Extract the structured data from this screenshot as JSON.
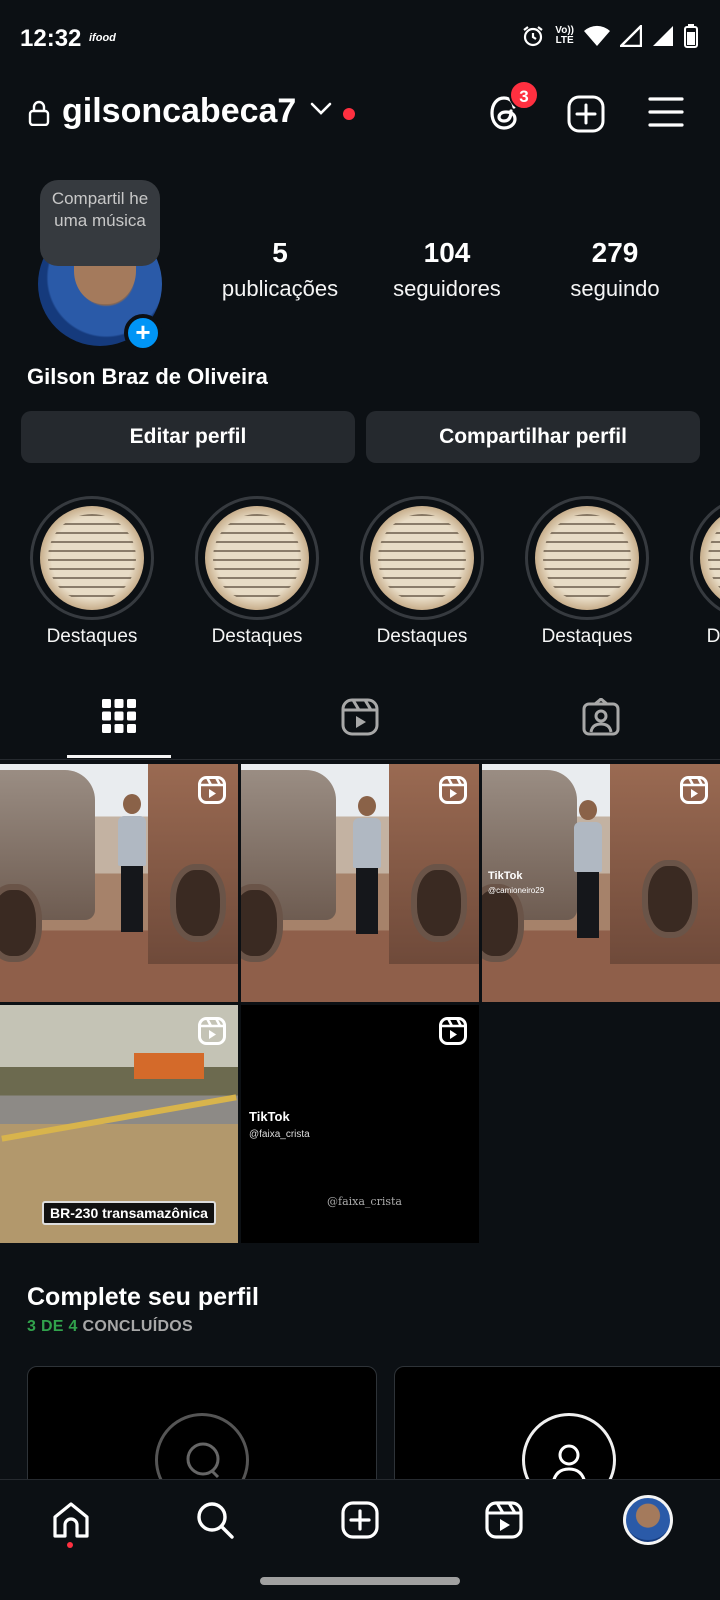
{
  "status_bar": {
    "time": "12:32",
    "app_notification": "ifood",
    "volte_line1": "Vo))",
    "volte_line2": "LTE",
    "icons": [
      "alarm-icon",
      "volte-icon",
      "wifi-icon",
      "signal-icon",
      "signal-icon",
      "battery-icon"
    ]
  },
  "header": {
    "username": "gilsoncabeca7",
    "threads_badge": "3",
    "icons": [
      "lock-icon",
      "chevron-down-icon",
      "threads-icon",
      "create-icon",
      "menu-icon"
    ]
  },
  "profile": {
    "note": "Compartil he uma música",
    "stats": {
      "posts_count": "5",
      "posts_label": "publicações",
      "followers_count": "104",
      "followers_label": "seguidores",
      "following_count": "279",
      "following_label": "seguindo"
    },
    "full_name": "Gilson Braz de Oliveira",
    "edit_button": "Editar perfil",
    "share_button": "Compartilhar perfil"
  },
  "highlights": [
    {
      "label": "Destaques"
    },
    {
      "label": "Destaques"
    },
    {
      "label": "Destaques"
    },
    {
      "label": "Destaques"
    },
    {
      "label": "Destaques"
    }
  ],
  "tabs": [
    "grid-icon",
    "reels-icon",
    "tagged-icon"
  ],
  "grid": {
    "posts": [
      {
        "type": "reel"
      },
      {
        "type": "reel"
      },
      {
        "type": "reel",
        "overlay_brand": "TikTok",
        "overlay_handle": "@camioneiro29"
      },
      {
        "type": "reel",
        "caption": "BR-230 transamazônica"
      },
      {
        "type": "reel",
        "overlay_brand": "TikTok",
        "overlay_handle": "@faixa_crista",
        "overlay_handle2": "@faixa_crista"
      }
    ]
  },
  "complete_profile": {
    "title": "Complete seu perfil",
    "progress_done": "3 DE 4",
    "progress_label": "CONCLUÍDOS"
  },
  "bottom_nav": [
    "home-icon",
    "search-icon",
    "create-icon",
    "reels-icon",
    "profile-avatar"
  ],
  "colors": {
    "background": "#0c1014",
    "button": "#25292e",
    "accent_blue": "#0095f6",
    "badge_red": "#ff3040",
    "success_green": "#31a24c"
  }
}
